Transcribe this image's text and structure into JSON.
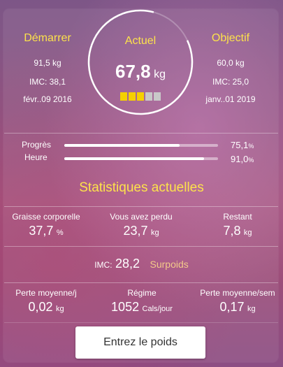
{
  "start": {
    "title": "Démarrer",
    "weight": "91,5 kg",
    "imc": "IMC: 38,1",
    "date": "févr..09 2016"
  },
  "current": {
    "title": "Actuel",
    "value": "67,8",
    "unit": "kg",
    "level_filled": 3,
    "level_total": 5
  },
  "goal": {
    "title": "Objectif",
    "weight": "60,0 kg",
    "imc": "IMC: 25,0",
    "date": "janv..01 2019"
  },
  "progress": {
    "rows": [
      {
        "label": "Progrès",
        "value": "75,1",
        "pct": 75.1
      },
      {
        "label": "Heure",
        "value": "91,0",
        "pct": 91.0
      }
    ],
    "unit": "%"
  },
  "stats_title": "Statistiques actuelles",
  "stats": {
    "fat": {
      "label": "Graisse corporelle",
      "value": "37,7",
      "unit": "%"
    },
    "lost": {
      "label": "Vous avez perdu",
      "value": "23,7",
      "unit": "kg"
    },
    "remaining": {
      "label": "Restant",
      "value": "7,8",
      "unit": "kg"
    }
  },
  "bmi": {
    "label": "IMC:",
    "value": "28,2",
    "status": "Surpoids"
  },
  "bottom": {
    "daily": {
      "label": "Perte moyenne/j",
      "value": "0,02",
      "unit": "kg"
    },
    "diet": {
      "label": "Régime",
      "value": "1052",
      "unit": "Cals/jour"
    },
    "weekly": {
      "label": "Perte moyenne/sem",
      "value": "0,17",
      "unit": "kg"
    }
  },
  "button_label": "Entrez le poids",
  "colors": {
    "gold": "#fde24b",
    "level_on": "#f5d000",
    "level_off": "#c8c8c8",
    "status": "#f3c98a"
  }
}
